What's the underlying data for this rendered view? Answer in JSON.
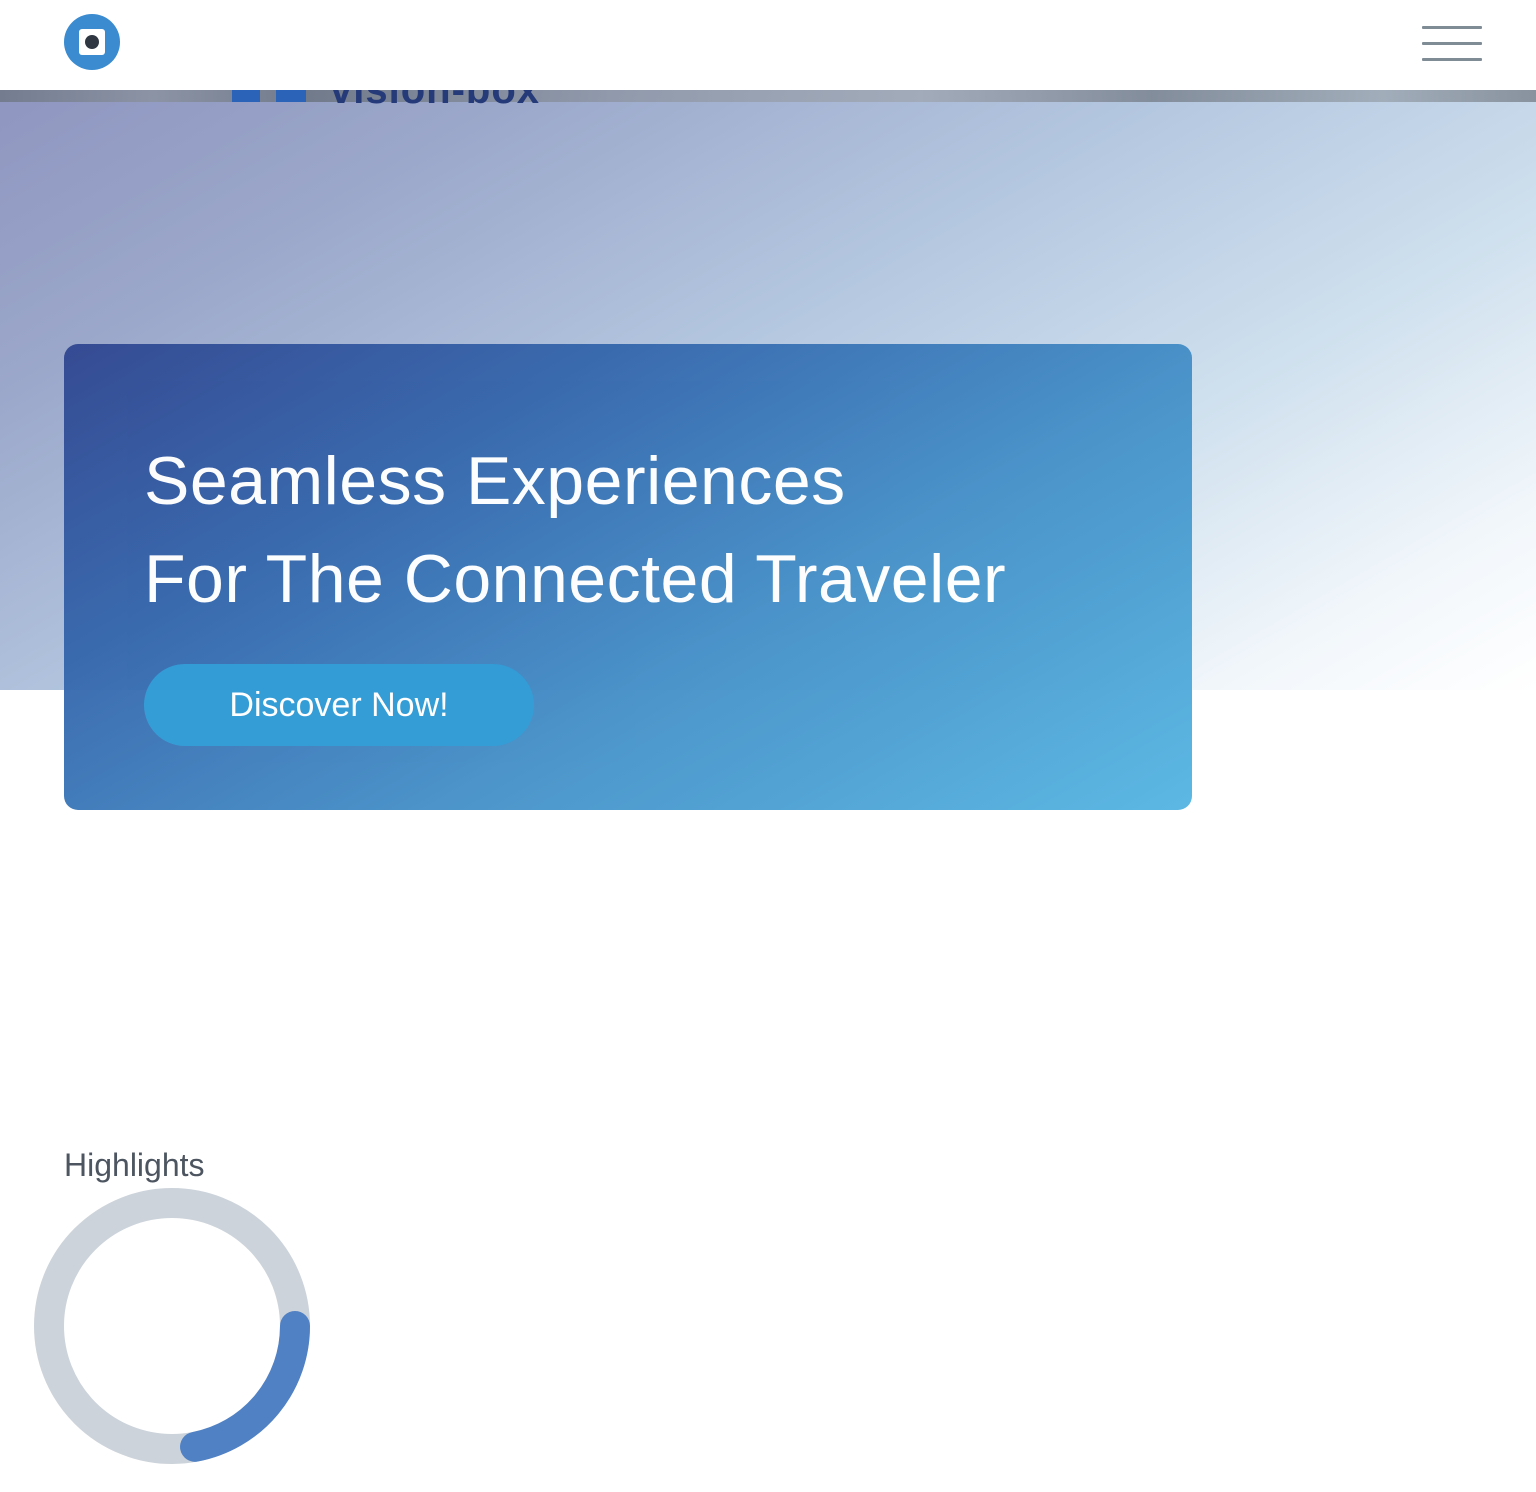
{
  "header": {
    "logo_icon": "logo-icon",
    "menu_icon": "hamburger-menu-icon"
  },
  "hero": {
    "background_photo_text": "vision-box",
    "title_line1": "Seamless Experiences",
    "title_line2": "For The Connected Traveler",
    "cta_label": "Discover Now!"
  },
  "highlights": {
    "label": "Highlights",
    "progress_fraction": 0.22
  },
  "colors": {
    "accent": "#3a8bd0",
    "cta": "#2f9ad5",
    "ring_track": "#ccd3da",
    "ring_fill": "#5081c4"
  }
}
